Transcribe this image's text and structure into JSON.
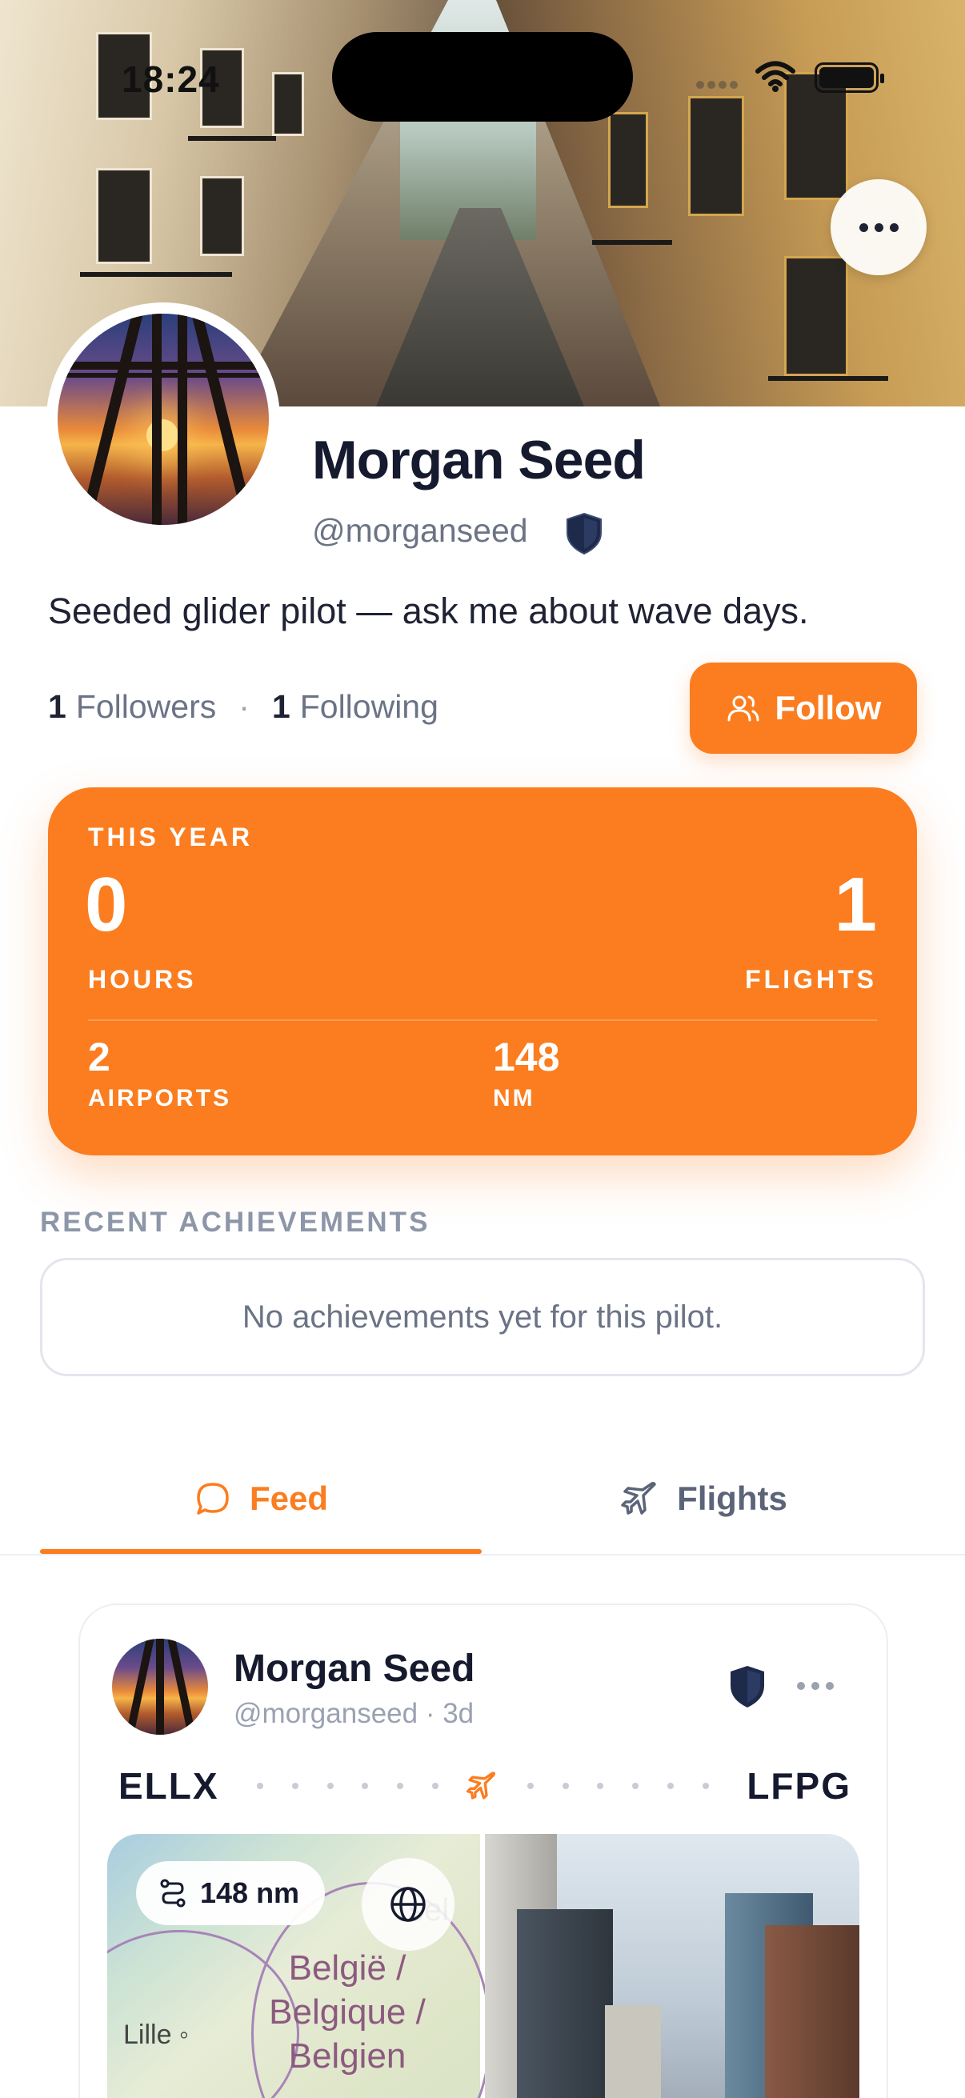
{
  "status_bar": {
    "time": "18:24"
  },
  "profile": {
    "name": "Morgan Seed",
    "handle": "@morganseed",
    "bio": "Seeded glider pilot — ask me about wave days.",
    "followers_count": "1",
    "followers_label": "Followers",
    "following_count": "1",
    "following_label": "Following",
    "follow_button": "Follow"
  },
  "stats": {
    "period": "THIS YEAR",
    "hours_value": "0",
    "hours_label": "HOURS",
    "flights_value": "1",
    "flights_label": "FLIGHTS",
    "airports_value": "2",
    "airports_label": "AIRPORTS",
    "nm_value": "148",
    "nm_label": "NM"
  },
  "achievements": {
    "title": "RECENT ACHIEVEMENTS",
    "empty": "No achievements yet for this pilot."
  },
  "tabs": [
    {
      "label": "Feed",
      "icon": "chat-bubble-icon",
      "active": true
    },
    {
      "label": "Flights",
      "icon": "plane-icon",
      "active": false
    }
  ],
  "post": {
    "name": "Morgan Seed",
    "meta": "@morganseed · 3d",
    "from": "ELLX",
    "to": "LFPG",
    "distance": "148 nm",
    "map_region": "België / Belgique / Belgien",
    "map_city": "Lille",
    "map_partial": "sel"
  },
  "colors": {
    "accent": "#fb7d1f",
    "shield": "#1e2a4a"
  }
}
